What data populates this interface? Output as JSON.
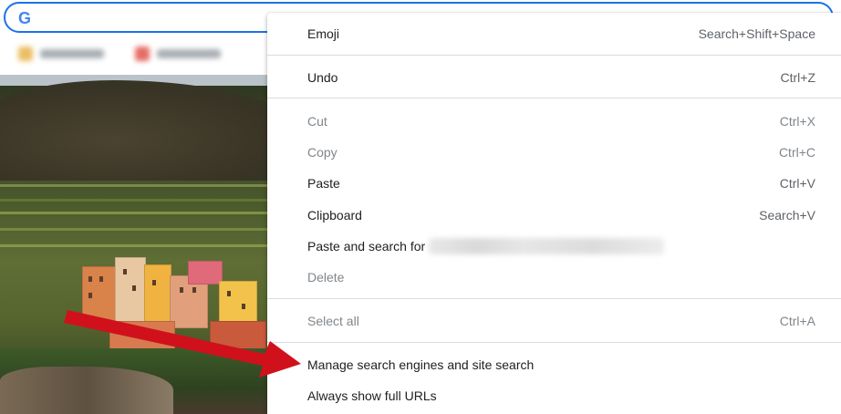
{
  "browser": {
    "omnibox_value": "",
    "logo_letter": "G",
    "colors": {
      "omnibox_border": "#1a73e8",
      "logo": "#4285f4"
    }
  },
  "context_menu": {
    "items": [
      {
        "label": "Emoji",
        "shortcut": "Search+Shift+Space",
        "disabled": false
      },
      {
        "label": "Undo",
        "shortcut": "Ctrl+Z",
        "disabled": false
      },
      {
        "label": "Cut",
        "shortcut": "Ctrl+X",
        "disabled": true
      },
      {
        "label": "Copy",
        "shortcut": "Ctrl+C",
        "disabled": true
      },
      {
        "label": "Paste",
        "shortcut": "Ctrl+V",
        "disabled": false
      },
      {
        "label": "Clipboard",
        "shortcut": "Search+V",
        "disabled": false
      },
      {
        "label": "Paste and search for",
        "shortcut": "",
        "disabled": false
      },
      {
        "label": "Delete",
        "shortcut": "",
        "disabled": true
      },
      {
        "label": "Select all",
        "shortcut": "Ctrl+A",
        "disabled": true
      },
      {
        "label": "Manage search engines and site search",
        "shortcut": "",
        "disabled": false
      },
      {
        "label": "Always show full URLs",
        "shortcut": "",
        "disabled": false
      }
    ]
  },
  "annotation": {
    "arrow_color": "#d0111b"
  }
}
